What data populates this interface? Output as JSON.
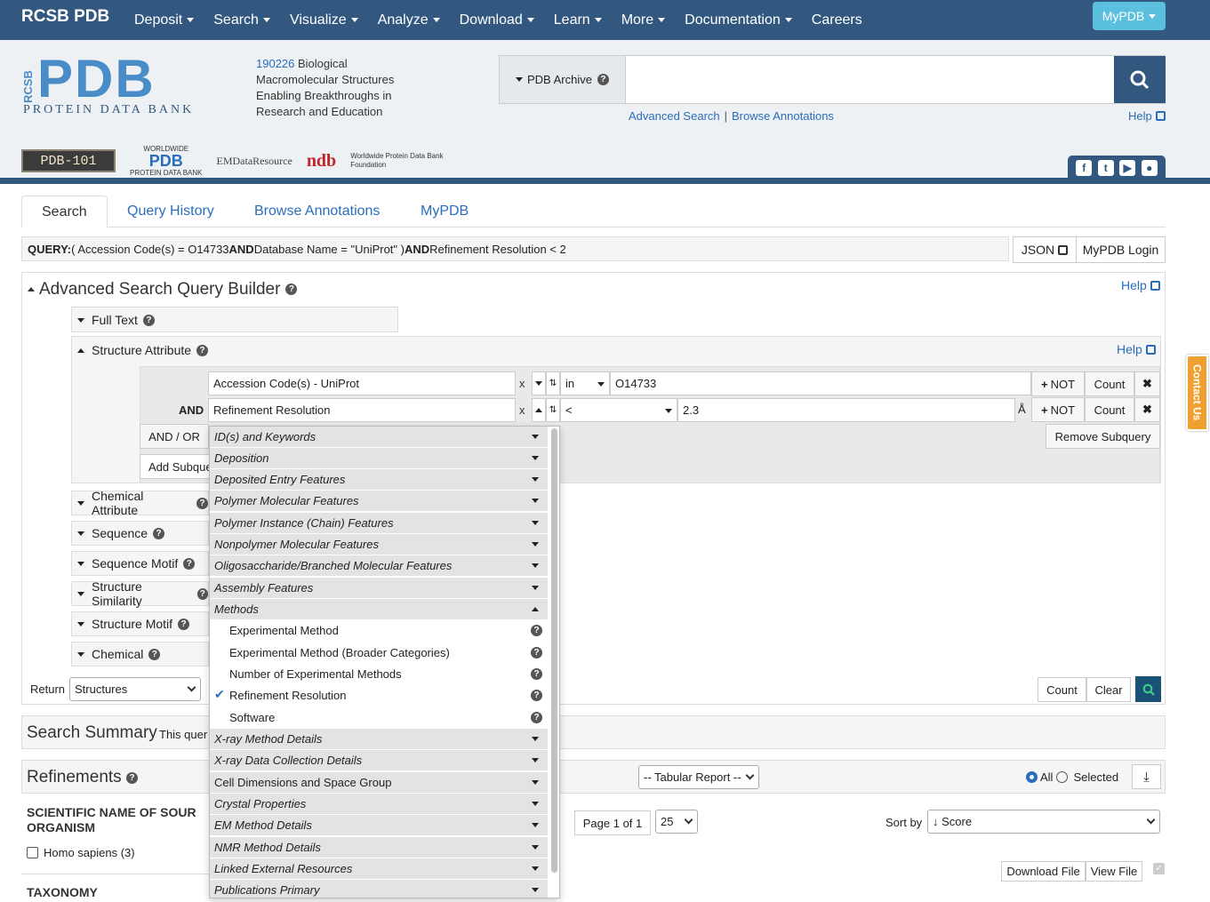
{
  "nav": {
    "brand": "RCSB PDB",
    "items": [
      "Deposit",
      "Search",
      "Visualize",
      "Analyze",
      "Download",
      "Learn",
      "More",
      "Documentation",
      "Careers"
    ],
    "mypdb": "MyPDB"
  },
  "header": {
    "logo_text": "PDB",
    "logo_side": "RCSB",
    "logo_sub": "PROTEIN DATA BANK",
    "count": "190226",
    "tagline": " Biological Macromolecular Structures Enabling Breakthroughs in Research and Education",
    "archive_label": "PDB Archive",
    "search_placeholder": "",
    "advanced_search": "Advanced Search",
    "browse_annotations": "Browse Annotations",
    "sep": "|",
    "help": "Help",
    "partners": {
      "pdb101": "PDB-101",
      "wwpdb_top": "WORLDWIDE",
      "wwpdb_main": "PDB",
      "wwpdb_sub": "PROTEIN DATA BANK",
      "emdr": "EMDataResource",
      "ndb": "ndb",
      "wwpdbf": "Worldwide Protein Data Bank Foundation"
    }
  },
  "tabs": [
    "Search",
    "Query History",
    "Browse Annotations",
    "MyPDB"
  ],
  "query": {
    "label": "QUERY:",
    "text": " ( Accession Code(s) = O14733 ",
    "and1": "AND",
    "text2": " Database Name = \"UniProt\" ) ",
    "and2": "AND",
    "text3": " Refinement Resolution < 2",
    "json": "JSON",
    "login": "MyPDB Login"
  },
  "builder": {
    "title": "Advanced Search Query Builder",
    "help": "Help",
    "full_text": "Full Text",
    "structure_attribute": "Structure Attribute",
    "sa_help": "Help",
    "row1": {
      "field": "Accession Code(s) - UniProt",
      "x": "x",
      "op": "in",
      "value": "O14733",
      "not": "NOT",
      "count": "Count"
    },
    "and_label": "AND",
    "row2": {
      "field": "Refinement Resolution",
      "x": "x",
      "op": "<",
      "value": "2.3",
      "unit": "Å",
      "not": "NOT",
      "count": "Count"
    },
    "and_or": "AND / OR",
    "remove_subquery": "Remove Subquery",
    "add_subquery": "Add Subquery",
    "sections": [
      "Chemical Attribute",
      "Sequence",
      "Sequence Motif",
      "Structure Similarity",
      "Structure Motif",
      "Chemical"
    ],
    "return_label": "Return",
    "return_value": "Structures",
    "count": "Count",
    "clear": "Clear"
  },
  "dropdown": {
    "groups_before": [
      "ID(s) and Keywords",
      "Deposition",
      "Deposited Entry Features",
      "Polymer Molecular Features",
      "Polymer Instance (Chain) Features",
      "Nonpolymer Molecular Features",
      "Oligosaccharide/Branched Molecular Features",
      "Assembly Features"
    ],
    "open_group": "Methods",
    "leaves": [
      "Experimental Method",
      "Experimental Method (Broader Categories)",
      "Number of Experimental Methods",
      "Refinement Resolution",
      "Software"
    ],
    "checked": "✔",
    "groups_after": [
      "X-ray Method Details",
      "X-ray Data Collection Details",
      "Cell Dimensions and Space Group",
      "Crystal Properties",
      "EM Method Details",
      "NMR Method Details",
      "Linked External Resources",
      "Publications Primary"
    ]
  },
  "summary": {
    "title": "Search Summary",
    "text": "This quer"
  },
  "refinements": {
    "title": "Refinements",
    "report": "-- Tabular Report --",
    "all": "All",
    "selected": "Selected",
    "facet_title1": "SCIENTIFIC NAME OF SOUR",
    "facet_title2": "ORGANISM",
    "facet_item": "Homo sapiens (3)",
    "taxonomy": "TAXONOMY",
    "page": "Page 1 of 1",
    "per_page": "25",
    "sort_label": "Sort by",
    "sort_value": "↓ Score",
    "download_file": "Download File",
    "view_file": "View File"
  },
  "contact": "Contact Us",
  "colors": {
    "nav": "#325880",
    "link": "#2a6ebb",
    "accent": "#5bc0de",
    "contact": "#f0a030",
    "search_go": "#1a7a5a"
  }
}
